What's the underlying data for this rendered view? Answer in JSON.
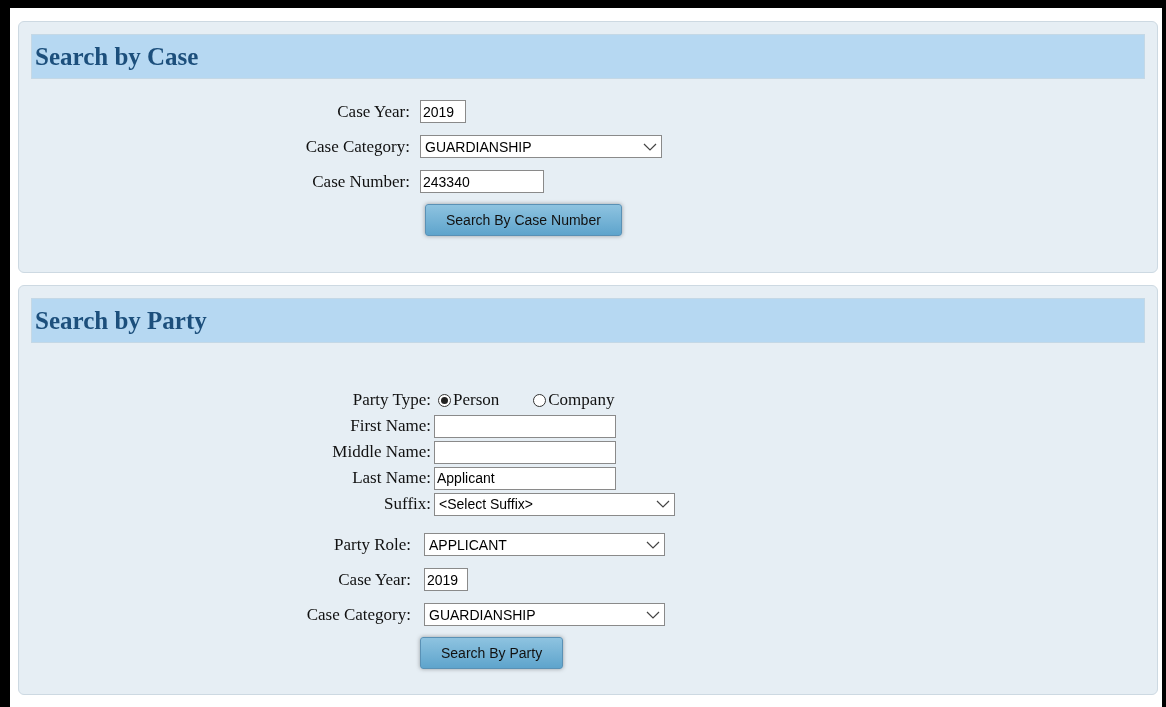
{
  "sections": [
    {
      "title": "Search by Case",
      "groups": [
        [
          {
            "kind": "text",
            "label": "Case Year:",
            "value": "2019"
          },
          {
            "kind": "select",
            "label": "Case Category:",
            "value": "GUARDIANSHIP"
          },
          {
            "kind": "text",
            "label": "Case Number:",
            "value": "243340"
          }
        ]
      ],
      "button": "Search By Case Number"
    },
    {
      "title": "Search by Party",
      "groups": [
        [
          {
            "kind": "radio",
            "label": "Party Type:",
            "options": [
              {
                "label": "Person",
                "selected": true
              },
              {
                "label": "Company",
                "selected": false
              }
            ]
          },
          {
            "kind": "text",
            "label": "First Name:"
          },
          {
            "kind": "text",
            "label": "Middle Name:"
          },
          {
            "kind": "text",
            "label": "Last Name:",
            "value": "Applicant"
          },
          {
            "kind": "select",
            "label": "Suffix:",
            "value": "<Select Suffix>"
          }
        ],
        [
          {
            "kind": "select",
            "label": "Party Role:",
            "value": "APPLICANT"
          },
          {
            "kind": "text",
            "label": "Case Year:",
            "value": "2019"
          },
          {
            "kind": "select",
            "label": "Case Category:",
            "value": "GUARDIANSHIP"
          }
        ]
      ],
      "button": "Search By Party"
    }
  ]
}
